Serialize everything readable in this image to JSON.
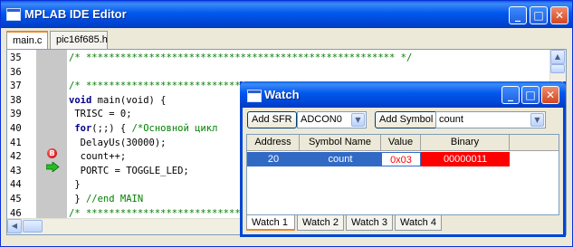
{
  "editor": {
    "title": "MPLAB IDE Editor",
    "tabs": [
      "main.c",
      "pic16f685.h"
    ],
    "line_numbers": [
      "35",
      "36",
      "37",
      "38",
      "39",
      "40",
      "41",
      "42",
      "43",
      "44",
      "45",
      "46"
    ],
    "code": {
      "l35": "/* ****************************************************** */",
      "l37": "/* *****************************************************",
      "l38_kw": "void",
      "l38_rest": " main(void) {",
      "l39": " TRISC = 0;",
      "l40_kw": "for",
      "l40_rest": "(;;) { ",
      "l40_com": "/*Основной цикл",
      "l41": "  DelayUs(30000);",
      "l42": "  count++;",
      "l43": "  PORTC = TOGGLE_LED;",
      "l44": " }",
      "l45_a": " } ",
      "l45_com": "//end MAIN",
      "l46": "/* *****************************************************"
    },
    "breakpoint_marker": "B"
  },
  "watch": {
    "title": "Watch",
    "add_sfr_label": "Add SFR",
    "sfr_selected": "ADCON0",
    "add_symbol_label": "Add Symbol",
    "symbol_selected": "count",
    "columns": [
      "Address",
      "Symbol Name",
      "Value",
      "Binary"
    ],
    "rows": [
      {
        "address": "20",
        "symbol": "count",
        "value": "0x03",
        "binary": "00000011"
      }
    ],
    "tabs": [
      "Watch 1",
      "Watch 2",
      "Watch 3",
      "Watch 4"
    ],
    "colors": {
      "selected_row": "#316ac5",
      "changed_value_text": "#ff0000",
      "binary_highlight": "#ff0000"
    }
  }
}
